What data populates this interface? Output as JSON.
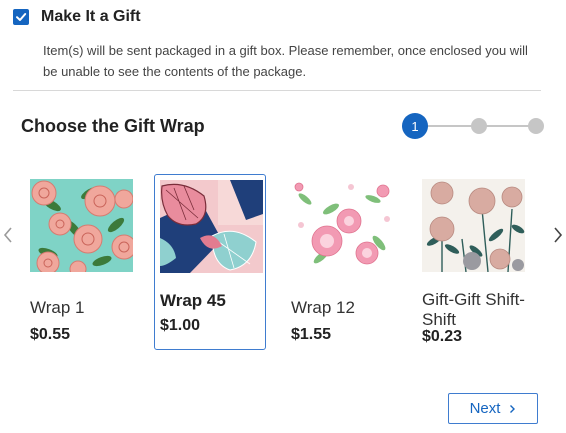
{
  "gift": {
    "checked": true,
    "label": "Make It a Gift",
    "note": "Item(s) will be sent packaged in a gift box. Please remember, once enclosed you will be unable to see the contents of the package."
  },
  "section": {
    "title": "Choose the Gift Wrap"
  },
  "stepper": {
    "current": "1",
    "total_steps": 3
  },
  "wraps": [
    {
      "name": "Wrap 1",
      "price": "$0.55",
      "selected": false
    },
    {
      "name": "Wrap 45",
      "price": "$1.00",
      "selected": true
    },
    {
      "name": "Wrap 12",
      "price": "$1.55",
      "selected": false
    },
    {
      "name": "Gift-Gift Shift-Shift",
      "price": "$0.23",
      "selected": false
    }
  ],
  "carousel": {
    "prev_icon": "chevron-left-icon",
    "next_icon": "chevron-right-icon"
  },
  "actions": {
    "next_label": "Next",
    "next_icon": "chevron-right-icon"
  },
  "colors": {
    "accent": "#1565c0",
    "selected_border": "#3f7ccf",
    "inactive_step": "#c6c6c6"
  }
}
